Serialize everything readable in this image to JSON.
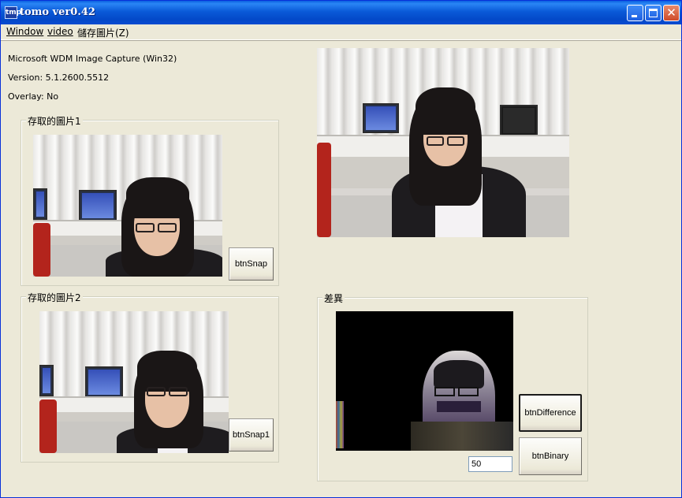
{
  "window": {
    "title": "tomo ver0.42",
    "icon_text": "tmp"
  },
  "menu": {
    "items": [
      "Window",
      "video",
      "儲存圖片(Z)"
    ]
  },
  "info": {
    "driver": "Microsoft WDM Image Capture (Win32)",
    "version": "Version:  5.1.2600.5512",
    "overlay": "Overlay: No"
  },
  "groups": {
    "capture1": "存取的圖片1",
    "capture2": "存取的圖片2",
    "difference": "差異"
  },
  "buttons": {
    "snap": "btnSnap",
    "snap1": "btnSnap1",
    "difference": "btnDifference",
    "binary": "btnBinary"
  },
  "threshold": {
    "value": "50"
  },
  "icons": {
    "minimize": "minimize-icon",
    "maximize": "maximize-icon",
    "close": "close-icon",
    "app": "app-icon"
  }
}
